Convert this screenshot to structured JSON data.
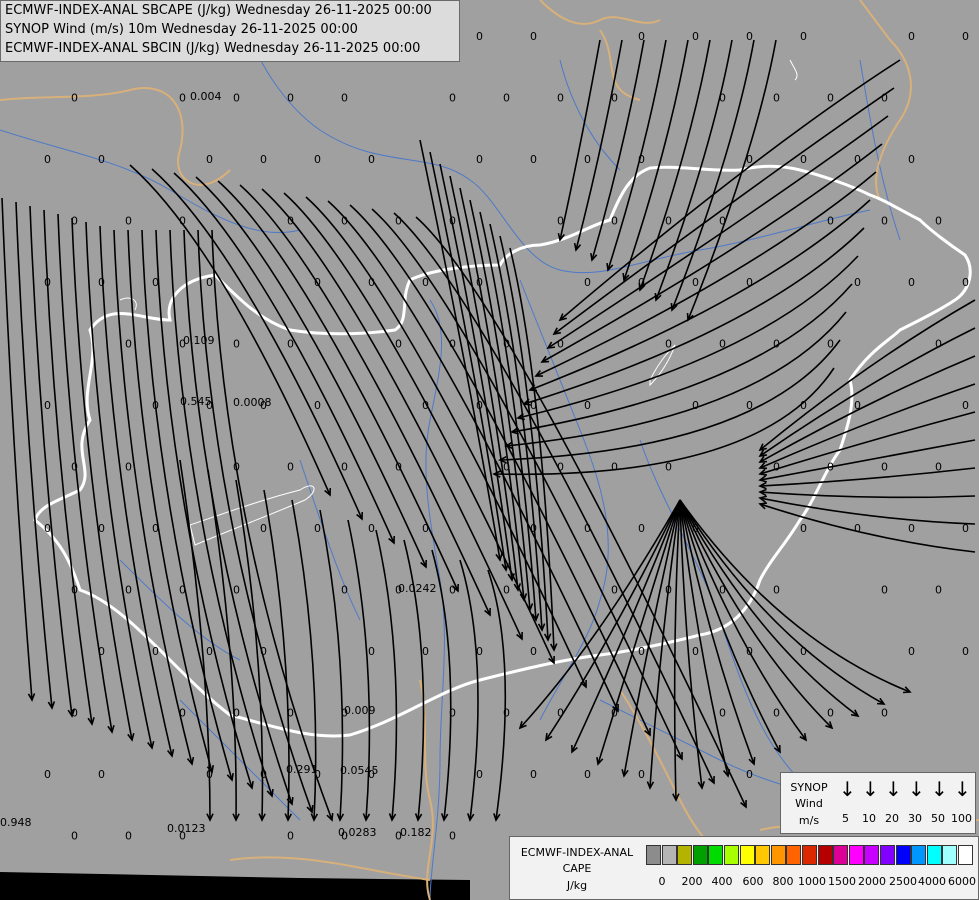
{
  "titles": [
    "ECMWF-INDEX-ANAL SBCAPE (J/kg) Wednesday 26-11-2025 00:00",
    "SYNOP Wind (m/s) 10m Wednesday 26-11-2025 00:00",
    "ECMWF-INDEX-ANAL SBCIN (J/kg) Wednesday 26-11-2025 00:00"
  ],
  "colors": {
    "background": "#a0a0a0",
    "country_border": "#ffffff",
    "other_borders": "#d8b07a",
    "rivers": "#4e79c8",
    "streamlines": "#000000"
  },
  "map_values": [
    [
      "0.004"
    ],
    [
      "0.109"
    ],
    [
      "0.545"
    ],
    [
      "0.0008"
    ],
    [
      "0.0242"
    ],
    [
      "0.009"
    ],
    [
      "0.291"
    ],
    [
      "0.0545"
    ],
    [
      "0.948"
    ],
    [
      "0.0123"
    ],
    [
      "0.0283"
    ],
    [
      "0.182"
    ]
  ],
  "zero_label": "0",
  "legend_wind": {
    "title_lines": [
      "SYNOP",
      "Wind",
      "m/s"
    ],
    "speeds": [
      "5",
      "10",
      "20",
      "30",
      "50",
      "100"
    ]
  },
  "legend_cape": {
    "title_lines": [
      "ECMWF-INDEX-ANAL",
      "CAPE",
      "J/kg"
    ],
    "colors": [
      "#8c8c8c",
      "#b4b4b4",
      "#b4b400",
      "#00a000",
      "#00dc00",
      "#a8ff00",
      "#ffff00",
      "#ffc800",
      "#ff9600",
      "#ff6400",
      "#dc2800",
      "#b40000",
      "#dc0096",
      "#ff00ff",
      "#c800ff",
      "#8200ff",
      "#0000ff",
      "#0096ff",
      "#00ffff",
      "#a0ffff",
      "#ffffff"
    ],
    "ticks": [
      "0",
      "200",
      "400",
      "600",
      "800",
      "1000",
      "1500",
      "2000",
      "2500",
      "4000",
      "6000"
    ]
  }
}
